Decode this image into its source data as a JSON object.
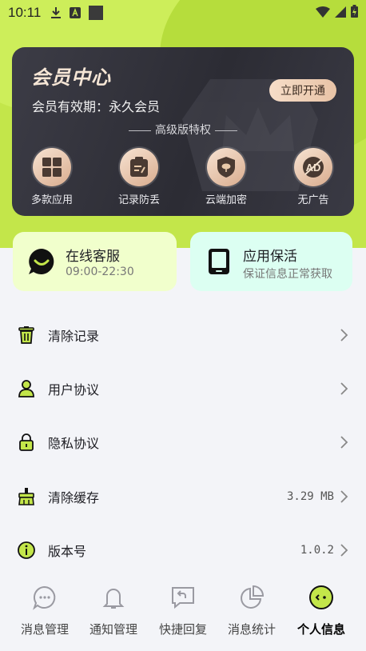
{
  "status_bar": {
    "time": "10:11"
  },
  "vip": {
    "title": "会员中心",
    "validity": "会员有效期：永久会员",
    "open_button": "立即开通",
    "privilege_heading": "高级版特权",
    "privileges": [
      {
        "label": "多款应用",
        "icon": "apps-grid-icon"
      },
      {
        "label": "记录防丢",
        "icon": "clipboard-edit-icon"
      },
      {
        "label": "云端加密",
        "icon": "cloud-shield-icon"
      },
      {
        "label": "无广告",
        "icon": "no-ad-icon"
      }
    ]
  },
  "quick_cards": {
    "service": {
      "title": "在线客服",
      "subtitle": "09:00-22:30",
      "icon": "chat-bubble-icon"
    },
    "keep_alive": {
      "title": "应用保活",
      "subtitle": "保证信息正常获取",
      "icon": "tablet-icon"
    }
  },
  "menu": [
    {
      "label": "清除记录",
      "value": "",
      "icon": "trash-icon"
    },
    {
      "label": "用户协议",
      "value": "",
      "icon": "user-icon"
    },
    {
      "label": "隐私协议",
      "value": "",
      "icon": "lock-icon"
    },
    {
      "label": "清除缓存",
      "value": "3.29 MB",
      "icon": "broom-icon"
    },
    {
      "label": "版本号",
      "value": "1.0.2",
      "icon": "info-icon"
    }
  ],
  "tabs": [
    {
      "label": "消息管理",
      "icon": "message-icon",
      "active": false
    },
    {
      "label": "通知管理",
      "icon": "bell-icon",
      "active": false
    },
    {
      "label": "快捷回复",
      "icon": "reply-icon",
      "active": false
    },
    {
      "label": "消息统计",
      "icon": "pie-chart-icon",
      "active": false
    },
    {
      "label": "个人信息",
      "icon": "profile-face-icon",
      "active": true
    }
  ],
  "colors": {
    "accent": "#c3e64a",
    "vip_dark": "#2f2f38",
    "gold": "#e8c3a6",
    "service_bg": "#f1ffcc",
    "keep_bg": "#dcfff2"
  }
}
